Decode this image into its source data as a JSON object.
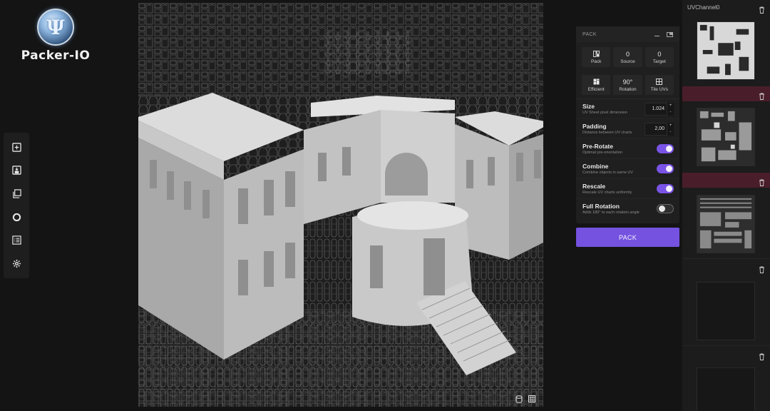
{
  "logo": {
    "glyph": "Ψ",
    "text": "Packer-IO"
  },
  "toolbar": {
    "items": [
      "add-icon",
      "save-icon",
      "layers-icon",
      "circle-icon",
      "list-icon",
      "gear-icon"
    ]
  },
  "viewport": {
    "bottom_icons": [
      "database-icon",
      "grid-icon"
    ]
  },
  "pack_panel": {
    "title": "PACK",
    "top_cells": [
      {
        "value": "",
        "label": "Pack"
      },
      {
        "value": "0",
        "label": "Source"
      },
      {
        "value": "0",
        "label": "Target"
      }
    ],
    "mode_cells": [
      {
        "value": "",
        "label": "Efficient"
      },
      {
        "value": "90°",
        "label": "Rotation"
      },
      {
        "value": "",
        "label": "Tile UVs"
      }
    ],
    "size": {
      "label": "Size",
      "desc": "UV Sheet pixel dimension",
      "value": "1.024"
    },
    "padding": {
      "label": "Padding",
      "desc": "Distance between UV charts",
      "value": "2,00"
    },
    "toggles": [
      {
        "label": "Pre-Rotate",
        "desc": "Optimal pre-orientation",
        "on": true
      },
      {
        "label": "Combine",
        "desc": "Combine objects in same UV",
        "on": true
      },
      {
        "label": "Rescale",
        "desc": "Rescale UV charts uniformly",
        "on": true
      },
      {
        "label": "Full Rotation",
        "desc": "Adds 180° to each rotation angle",
        "on": false
      }
    ],
    "pack_button": "PACK",
    "accent": "#7552e0"
  },
  "uv_panel": {
    "channel": "UVChannel0",
    "highlight": "#4a1d2a"
  }
}
